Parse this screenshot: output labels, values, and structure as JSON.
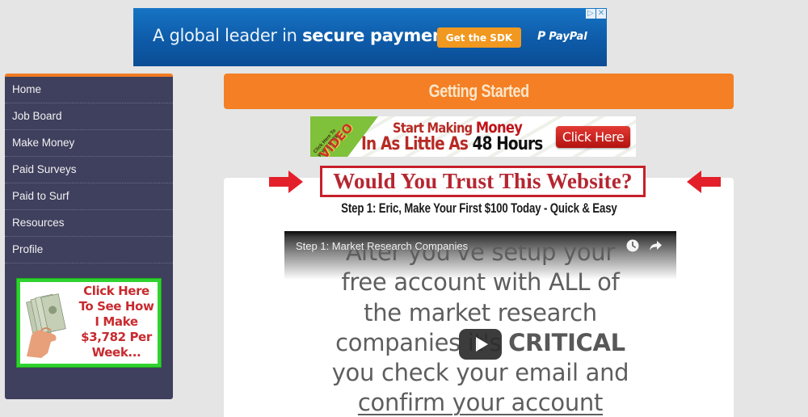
{
  "top_ad": {
    "text_regular": "A global leader in ",
    "text_bold": "secure payments",
    "button_label": "Get the SDK",
    "brand": "PayPal",
    "brand_mark": "P",
    "adchoices_icon": "adchoices-icon",
    "close_icon": "close-icon",
    "colors": {
      "background": "#0e5ba9",
      "button": "#f0981f"
    }
  },
  "sidebar": {
    "accent_color": "#f07b22",
    "background_color": "#3f3f5e",
    "items": [
      {
        "label": "Home"
      },
      {
        "label": "Job Board"
      },
      {
        "label": "Make Money"
      },
      {
        "label": "Paid Surveys"
      },
      {
        "label": "Paid to Surf"
      },
      {
        "label": "Resources"
      },
      {
        "label": "Profile"
      }
    ],
    "ad": {
      "lines": [
        "Click Here",
        "To See How",
        "I Make",
        "$3,782 Per",
        "Week..."
      ],
      "image": "cash-in-hand"
    }
  },
  "header": {
    "title": "Getting Started",
    "color": "#f47f24"
  },
  "video_ad": {
    "ribbon_small": "Click Here To Watch FREE",
    "ribbon_big": "VIDEO",
    "line1_regular": "Start Making ",
    "line1_bold": "Money",
    "line2_regular": "In As Little As ",
    "line2_bold": "48 Hours",
    "button_label": "Click Here"
  },
  "annotation": {
    "callout": "Would You Trust This Website?",
    "color": "#c8202a",
    "arrows": [
      "arrow-right-icon",
      "arrow-left-icon"
    ]
  },
  "content": {
    "step_title": "Step 1: Eric, Make Your First $100 Today - Quick & Easy",
    "video": {
      "title": "Step 1: Market Research Companies",
      "icons": [
        "clock-icon",
        "share-icon",
        "play-icon"
      ],
      "slide_lines": [
        "After you've setup your",
        "free account with ALL of",
        "the market research",
        "companies it's ",
        "CRITICAL",
        "you check your email and",
        "confirm your account"
      ]
    }
  }
}
